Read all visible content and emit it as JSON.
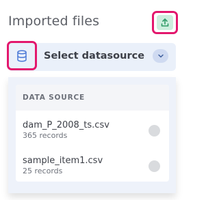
{
  "panel": {
    "title": "Imported files"
  },
  "upload_button": {
    "icon": "upload-icon",
    "accent": "#e3176d",
    "icon_bg": "#cdeede",
    "icon_color": "#2f9a67"
  },
  "datasource_select": {
    "icon": "database-icon",
    "label": "Select datasource",
    "chevron_icon": "chevron-down-icon",
    "accent": "#4a78d6"
  },
  "dropdown": {
    "section_header": "DATA SOURCE",
    "items": [
      {
        "name": "dam_P_2008_ts.csv",
        "records": "365 records",
        "selected": false
      },
      {
        "name": "sample_item1.csv",
        "records": "25 records",
        "selected": false
      }
    ]
  }
}
